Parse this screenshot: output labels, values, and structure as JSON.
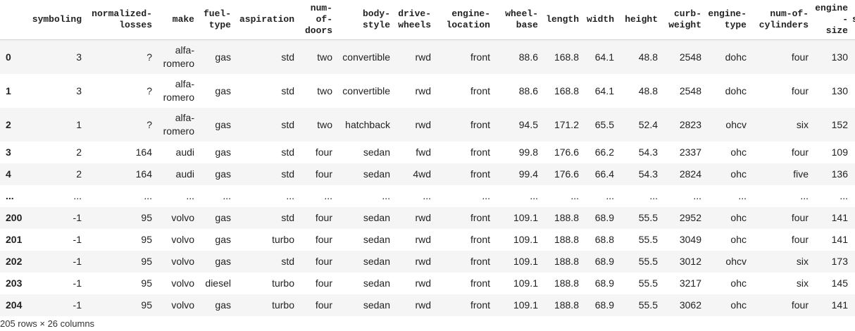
{
  "dataframe": {
    "columns": [
      "symboling",
      "normalized-\nlosses",
      "make",
      "fuel-\ntype",
      "aspiration",
      "num-\nof-\ndoors",
      "body-\nstyle",
      "drive-\nwheels",
      "engine-\nlocation",
      "wheel-\nbase",
      "length",
      "width",
      "height",
      "curb-\nweight",
      "engine-\ntype",
      "num-of-\ncylinders",
      "engine-\nsize",
      "s"
    ],
    "rows": [
      {
        "index": "0",
        "cells": [
          "3",
          "?",
          "alfa-\nromero",
          "gas",
          "std",
          "two",
          "convertible",
          "rwd",
          "front",
          "88.6",
          "168.8",
          "64.1",
          "48.8",
          "2548",
          "dohc",
          "four",
          "130",
          ""
        ]
      },
      {
        "index": "1",
        "cells": [
          "3",
          "?",
          "alfa-\nromero",
          "gas",
          "std",
          "two",
          "convertible",
          "rwd",
          "front",
          "88.6",
          "168.8",
          "64.1",
          "48.8",
          "2548",
          "dohc",
          "four",
          "130",
          ""
        ]
      },
      {
        "index": "2",
        "cells": [
          "1",
          "?",
          "alfa-\nromero",
          "gas",
          "std",
          "two",
          "hatchback",
          "rwd",
          "front",
          "94.5",
          "171.2",
          "65.5",
          "52.4",
          "2823",
          "ohcv",
          "six",
          "152",
          ""
        ]
      },
      {
        "index": "3",
        "cells": [
          "2",
          "164",
          "audi",
          "gas",
          "std",
          "four",
          "sedan",
          "fwd",
          "front",
          "99.8",
          "176.6",
          "66.2",
          "54.3",
          "2337",
          "ohc",
          "four",
          "109",
          ""
        ]
      },
      {
        "index": "4",
        "cells": [
          "2",
          "164",
          "audi",
          "gas",
          "std",
          "four",
          "sedan",
          "4wd",
          "front",
          "99.4",
          "176.6",
          "66.4",
          "54.3",
          "2824",
          "ohc",
          "five",
          "136",
          ""
        ]
      },
      {
        "index": "...",
        "cells": [
          "...",
          "...",
          "...",
          "...",
          "...",
          "...",
          "...",
          "...",
          "...",
          "...",
          "...",
          "...",
          "...",
          "...",
          "...",
          "...",
          "...",
          ""
        ]
      },
      {
        "index": "200",
        "cells": [
          "-1",
          "95",
          "volvo",
          "gas",
          "std",
          "four",
          "sedan",
          "rwd",
          "front",
          "109.1",
          "188.8",
          "68.9",
          "55.5",
          "2952",
          "ohc",
          "four",
          "141",
          ""
        ]
      },
      {
        "index": "201",
        "cells": [
          "-1",
          "95",
          "volvo",
          "gas",
          "turbo",
          "four",
          "sedan",
          "rwd",
          "front",
          "109.1",
          "188.8",
          "68.8",
          "55.5",
          "3049",
          "ohc",
          "four",
          "141",
          ""
        ]
      },
      {
        "index": "202",
        "cells": [
          "-1",
          "95",
          "volvo",
          "gas",
          "std",
          "four",
          "sedan",
          "rwd",
          "front",
          "109.1",
          "188.8",
          "68.9",
          "55.5",
          "3012",
          "ohcv",
          "six",
          "173",
          ""
        ]
      },
      {
        "index": "203",
        "cells": [
          "-1",
          "95",
          "volvo",
          "diesel",
          "turbo",
          "four",
          "sedan",
          "rwd",
          "front",
          "109.1",
          "188.8",
          "68.9",
          "55.5",
          "3217",
          "ohc",
          "six",
          "145",
          ""
        ]
      },
      {
        "index": "204",
        "cells": [
          "-1",
          "95",
          "volvo",
          "gas",
          "turbo",
          "four",
          "sedan",
          "rwd",
          "front",
          "109.1",
          "188.8",
          "68.9",
          "55.5",
          "3062",
          "ohc",
          "four",
          "141",
          ""
        ]
      }
    ],
    "shape_text": "205 rows × 26 columns",
    "colors": {
      "stripe": "#f5f5f5",
      "header_rule": "#cfcfcf",
      "text": "#222222"
    }
  }
}
